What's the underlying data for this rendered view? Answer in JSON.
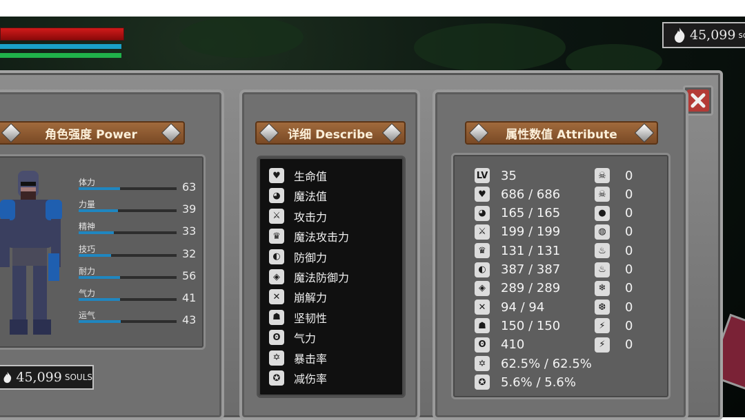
{
  "hud": {
    "hp_fill": 1.0,
    "mp_fill": 1.0,
    "stamina_fill": 1.0,
    "souls_value": "45,099",
    "souls_unit": "sc"
  },
  "power_panel": {
    "title": "角色强度 Power",
    "stats": [
      {
        "label": "体力",
        "value": "63",
        "fill": 0.42
      },
      {
        "label": "力量",
        "value": "39",
        "fill": 0.4
      },
      {
        "label": "精神",
        "value": "33",
        "fill": 0.36
      },
      {
        "label": "技巧",
        "value": "32",
        "fill": 0.33
      },
      {
        "label": "耐力",
        "value": "56",
        "fill": 0.42
      },
      {
        "label": "气力",
        "value": "41",
        "fill": 0.42
      },
      {
        "label": "运气",
        "value": "43",
        "fill": 0.43
      }
    ],
    "souls_value": "45,099",
    "souls_unit": "SOULS"
  },
  "describe_panel": {
    "title": "详细 Describe",
    "items": [
      {
        "icon": "heart-icon",
        "label": "生命值"
      },
      {
        "icon": "head-icon",
        "label": "魔法值"
      },
      {
        "icon": "sword-icon",
        "label": "攻击力"
      },
      {
        "icon": "crown-icon",
        "label": "魔法攻击力"
      },
      {
        "icon": "shield-icon",
        "label": "防御力"
      },
      {
        "icon": "magic-shield-icon",
        "label": "魔法防御力"
      },
      {
        "icon": "break-icon",
        "label": "崩解力"
      },
      {
        "icon": "helmet-icon",
        "label": "坚韧性"
      },
      {
        "icon": "lungs-icon",
        "label": "气力"
      },
      {
        "icon": "crit-star-icon",
        "label": "暴击率"
      },
      {
        "icon": "damage-reduce-icon",
        "label": "减伤率"
      }
    ]
  },
  "attribute_panel": {
    "title": "属性数值 Attribute",
    "left": [
      {
        "icon": "level-icon",
        "icon_text": "LV",
        "value": "35"
      },
      {
        "icon": "heart-icon",
        "value": "686 / 686"
      },
      {
        "icon": "head-icon",
        "value": "165 / 165"
      },
      {
        "icon": "sword-icon",
        "value": "199 / 199"
      },
      {
        "icon": "crown-icon",
        "value": "131 / 131"
      },
      {
        "icon": "shield-icon",
        "value": "387 / 387"
      },
      {
        "icon": "magic-shield-icon",
        "value": "289 / 289"
      },
      {
        "icon": "break-icon",
        "value": "94 / 94"
      },
      {
        "icon": "helmet-icon",
        "value": "150 / 150"
      },
      {
        "icon": "lungs-icon",
        "value": "410"
      },
      {
        "icon": "crit-star-icon",
        "value": "62.5% / 62.5%"
      },
      {
        "icon": "damage-reduce-icon",
        "value": "5.6% / 5.6%"
      }
    ],
    "right": [
      {
        "icon": "skull-icon",
        "value": "0"
      },
      {
        "icon": "skull-resist-icon",
        "value": "0"
      },
      {
        "icon": "blood-drop-icon",
        "value": "0"
      },
      {
        "icon": "bleed-resist-icon",
        "value": "0"
      },
      {
        "icon": "fire-icon",
        "value": "0"
      },
      {
        "icon": "fire-resist-icon",
        "value": "0"
      },
      {
        "icon": "frost-icon",
        "value": "0"
      },
      {
        "icon": "frost-resist-icon",
        "value": "0"
      },
      {
        "icon": "lightning-icon",
        "value": "0"
      },
      {
        "icon": "lightning-resist-icon",
        "value": "0"
      }
    ]
  }
}
